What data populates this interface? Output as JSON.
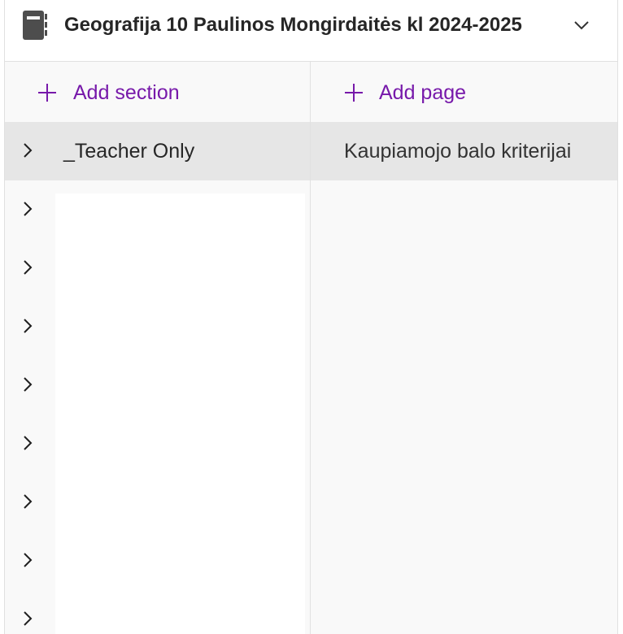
{
  "header": {
    "notebook_title": "Geografija 10 Paulinos Mongirdaitės kl 2024-2025",
    "notebook_icon": "notebook-icon",
    "expand_icon": "chevron-down-icon"
  },
  "sections_pane": {
    "add_label": "Add section",
    "add_icon": "plus-icon",
    "items": [
      {
        "label": "_Teacher Only",
        "selected": true
      },
      {
        "label": "",
        "selected": false
      },
      {
        "label": "",
        "selected": false
      },
      {
        "label": "",
        "selected": false
      },
      {
        "label": "",
        "selected": false
      },
      {
        "label": "",
        "selected": false
      },
      {
        "label": "",
        "selected": false
      },
      {
        "label": "",
        "selected": false
      },
      {
        "label": "",
        "selected": false
      }
    ]
  },
  "pages_pane": {
    "add_label": "Add page",
    "add_icon": "plus-icon",
    "items": [
      {
        "label": "Kaupiamojo balo kriterijai",
        "selected": true
      }
    ]
  },
  "colors": {
    "accent": "#7719aa",
    "selected_row": "#e6e6e6",
    "pane_background": "#f9f9f9",
    "text": "#262626"
  }
}
